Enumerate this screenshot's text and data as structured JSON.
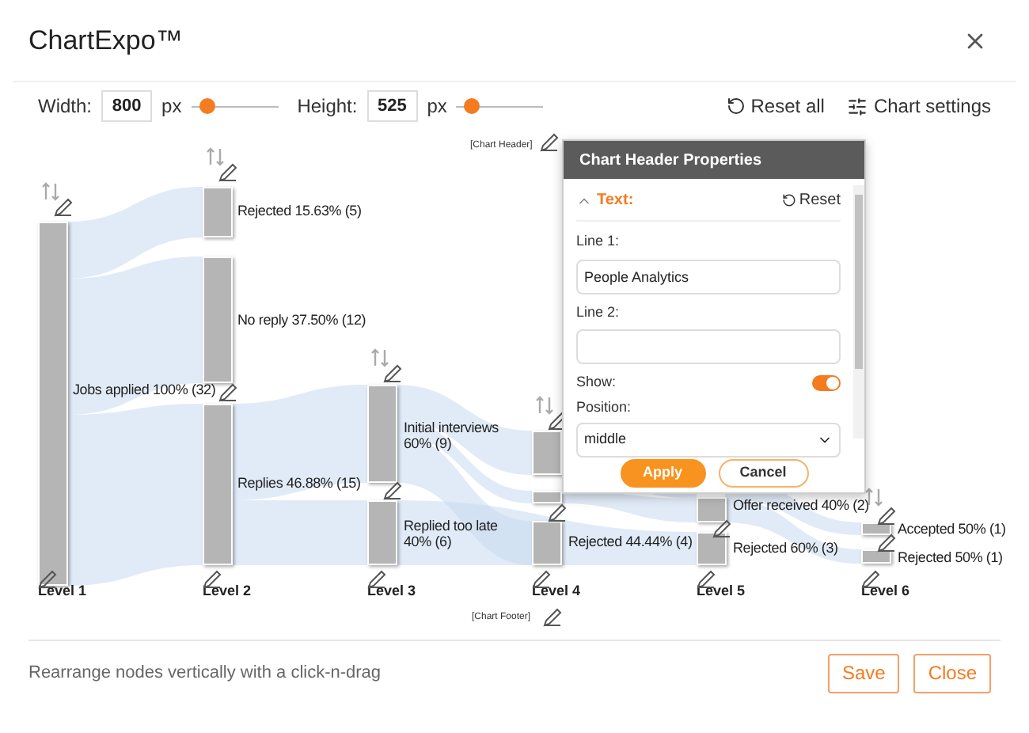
{
  "window": {
    "title": "ChartExpo™"
  },
  "toolbar": {
    "width": {
      "label": "Width:",
      "value": "800",
      "unit": "px",
      "level": 0.18
    },
    "height": {
      "label": "Height:",
      "value": "525",
      "unit": "px",
      "level": 0.18
    },
    "reset_all": "Reset all",
    "chart_settings": "Chart settings"
  },
  "chart": {
    "header_placeholder": "[Chart Header]",
    "footer_placeholder": "[Chart Footer]",
    "levels": [
      "Level 1",
      "Level 2",
      "Level 3",
      "Level 4",
      "Level 5",
      "Level 6"
    ],
    "node_labels": [
      "Jobs applied 100% (32)",
      "Rejected 15.63% (5)",
      "No reply 37.50% (12)",
      "Replies 46.88% (15)",
      "Initial interviews 60% (9)",
      "Replied too late 40% (6)",
      "Rejected 44.44% (4)",
      "Offer received 40% (2)",
      "Rejected 60% (3)",
      "Accepted 50% (1)",
      "Rejected 50% (1)"
    ]
  },
  "popup": {
    "title": "Chart Header Properties",
    "section": "Text:",
    "expanded": true,
    "reset": "Reset",
    "line1": {
      "label": "Line 1:",
      "value": "People Analytics"
    },
    "line2": {
      "label": "Line 2:"
    },
    "show": {
      "label": "Show:",
      "on": true
    },
    "position": {
      "label": "Position:",
      "value": "middle"
    },
    "apply": "Apply",
    "cancel": "Cancel"
  },
  "footer": {
    "hint": "Rearrange nodes vertically with a click-n-drag",
    "save": "Save",
    "close": "Close"
  }
}
